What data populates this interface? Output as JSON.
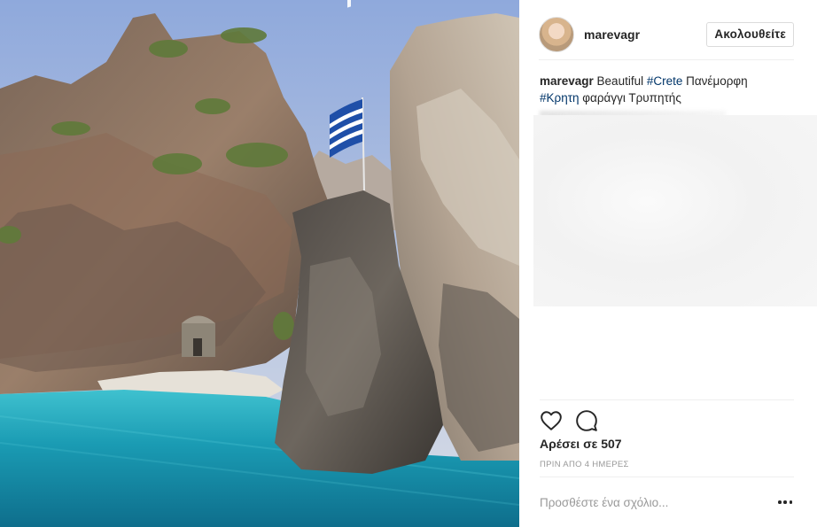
{
  "post": {
    "username": "marevagr",
    "follow_label": "Ακολουθείτε",
    "caption": {
      "username": "marevagr",
      "text_1": " Beautiful ",
      "tag_1": "#Crete",
      "text_2": " Πανέμορφη ",
      "tag_2": "#Κρητη",
      "text_3": " φαράγγι Τρυπητής"
    },
    "likes": "Αρέσει σε 507",
    "timestamp": "ΠΡΙΝ ΑΠΟ 4 ΗΜΕΡΕΣ",
    "comment_placeholder": "Προσθέστε ένα σχόλιο..."
  },
  "icons": {
    "like": "heart-icon",
    "comment": "comment-bubble-icon",
    "more": "more-options-icon"
  },
  "colors": {
    "hashtag": "#003569",
    "sea": "#1aa3b8",
    "flag_blue": "#1f4fa8"
  }
}
